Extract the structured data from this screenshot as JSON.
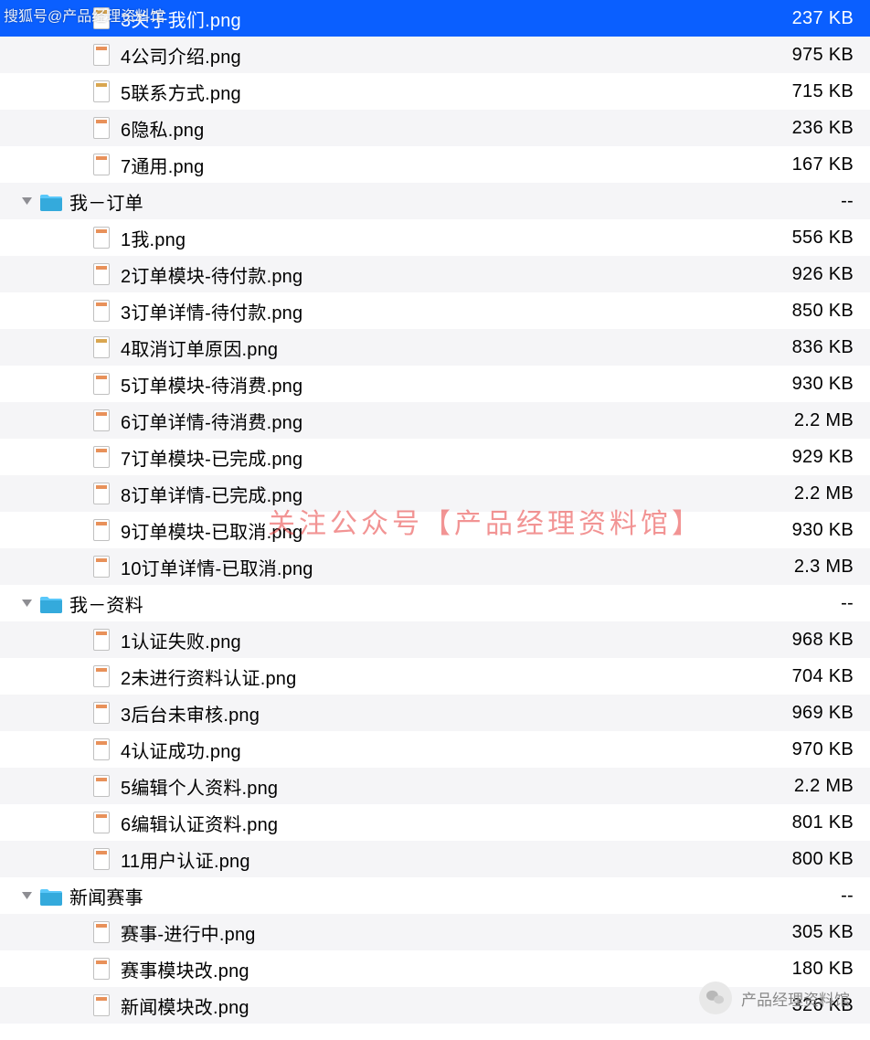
{
  "watermarks": {
    "top_left": "搜狐号@产品经理资料馆",
    "center": "关注公众号【产品经理资料馆】",
    "wechat": "产品经理资料馆"
  },
  "empty_size": "--",
  "rows": [
    {
      "name": "3关于我们.png",
      "size": "237 KB",
      "type": "file",
      "indent": 3,
      "selected": true,
      "iconvar": "a"
    },
    {
      "name": "4公司介绍.png",
      "size": "975 KB",
      "type": "file",
      "indent": 3,
      "iconvar": "b"
    },
    {
      "name": "5联系方式.png",
      "size": "715 KB",
      "type": "file",
      "indent": 3,
      "iconvar": "a"
    },
    {
      "name": "6隐私.png",
      "size": "236 KB",
      "type": "file",
      "indent": 3,
      "iconvar": "b"
    },
    {
      "name": "7通用.png",
      "size": "167 KB",
      "type": "file",
      "indent": 3,
      "iconvar": "b"
    },
    {
      "name": "我－订单",
      "size": "--",
      "type": "folder",
      "indent": 2,
      "expanded": true
    },
    {
      "name": "1我.png",
      "size": "556 KB",
      "type": "file",
      "indent": 3,
      "iconvar": "b"
    },
    {
      "name": "2订单模块-待付款.png",
      "size": "926 KB",
      "type": "file",
      "indent": 3,
      "iconvar": "b"
    },
    {
      "name": "3订单详情-待付款.png",
      "size": "850 KB",
      "type": "file",
      "indent": 3,
      "iconvar": "b"
    },
    {
      "name": "4取消订单原因.png",
      "size": "836 KB",
      "type": "file",
      "indent": 3,
      "iconvar": "a"
    },
    {
      "name": "5订单模块-待消费.png",
      "size": "930 KB",
      "type": "file",
      "indent": 3,
      "iconvar": "b"
    },
    {
      "name": "6订单详情-待消费.png",
      "size": "2.2 MB",
      "type": "file",
      "indent": 3,
      "iconvar": "b"
    },
    {
      "name": "7订单模块-已完成.png",
      "size": "929 KB",
      "type": "file",
      "indent": 3,
      "iconvar": "b"
    },
    {
      "name": "8订单详情-已完成.png",
      "size": "2.2 MB",
      "type": "file",
      "indent": 3,
      "iconvar": "b"
    },
    {
      "name": "9订单模块-已取消.png",
      "size": "930 KB",
      "type": "file",
      "indent": 3,
      "iconvar": "b"
    },
    {
      "name": "10订单详情-已取消.png",
      "size": "2.3 MB",
      "type": "file",
      "indent": 3,
      "iconvar": "b"
    },
    {
      "name": "我－资料",
      "size": "--",
      "type": "folder",
      "indent": 2,
      "expanded": true
    },
    {
      "name": "1认证失败.png",
      "size": "968 KB",
      "type": "file",
      "indent": 3,
      "iconvar": "b"
    },
    {
      "name": "2未进行资料认证.png",
      "size": "704 KB",
      "type": "file",
      "indent": 3,
      "iconvar": "b"
    },
    {
      "name": "3后台未审核.png",
      "size": "969 KB",
      "type": "file",
      "indent": 3,
      "iconvar": "b"
    },
    {
      "name": "4认证成功.png",
      "size": "970 KB",
      "type": "file",
      "indent": 3,
      "iconvar": "b"
    },
    {
      "name": "5编辑个人资料.png",
      "size": "2.2 MB",
      "type": "file",
      "indent": 3,
      "iconvar": "b"
    },
    {
      "name": "6编辑认证资料.png",
      "size": "801 KB",
      "type": "file",
      "indent": 3,
      "iconvar": "b"
    },
    {
      "name": "11用户认证.png",
      "size": "800 KB",
      "type": "file",
      "indent": 3,
      "iconvar": "b"
    },
    {
      "name": "新闻赛事",
      "size": "--",
      "type": "folder",
      "indent": 2,
      "expanded": true
    },
    {
      "name": "赛事-进行中.png",
      "size": "305 KB",
      "type": "file",
      "indent": 3,
      "iconvar": "b"
    },
    {
      "name": "赛事模块改.png",
      "size": "180 KB",
      "type": "file",
      "indent": 3,
      "iconvar": "b"
    },
    {
      "name": "新闻模块改.png",
      "size": "326 KB",
      "type": "file",
      "indent": 3,
      "iconvar": "b"
    }
  ]
}
